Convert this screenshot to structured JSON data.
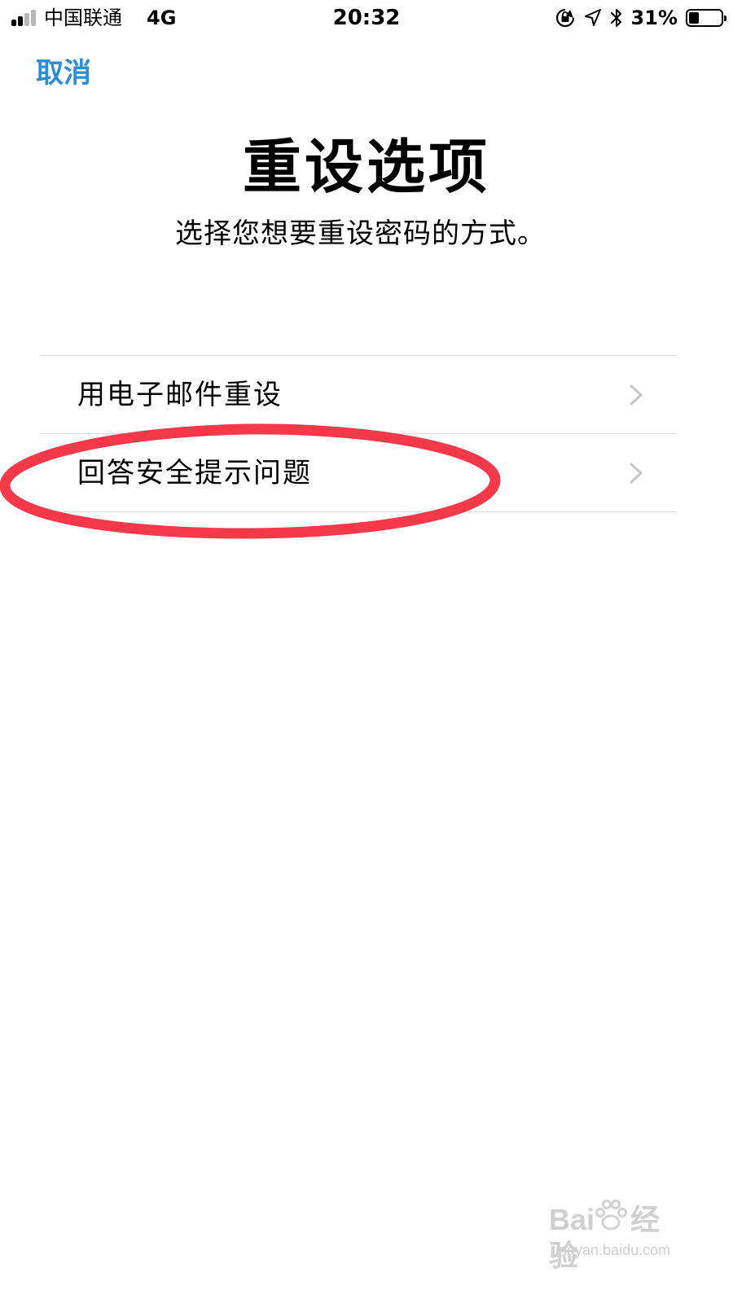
{
  "status_bar": {
    "carrier": "中国联通",
    "network": "4G",
    "time": "20:32",
    "battery_percent": "31%",
    "battery_level": 0.31,
    "icons": [
      "orientation-lock-icon",
      "location-arrow-icon",
      "bluetooth-icon",
      "battery-icon"
    ]
  },
  "nav": {
    "cancel_label": "取消"
  },
  "header": {
    "title": "重设选项",
    "subtitle": "选择您想要重设密码的方式。"
  },
  "options": [
    {
      "label": "用电子邮件重设",
      "icon": "chevron-right-icon"
    },
    {
      "label": "回答安全提示问题",
      "icon": "chevron-right-icon"
    }
  ],
  "annotation": {
    "color": "#f5384a",
    "target": "回答安全提示问题"
  },
  "watermark": {
    "brand_prefix": "Bai",
    "brand_suffix": "经验",
    "url": "jingyan.baidu.com"
  },
  "colors": {
    "accent": "#2a8cdc",
    "separator": "#dcdcdc",
    "chevron": "#c4c4c9"
  }
}
